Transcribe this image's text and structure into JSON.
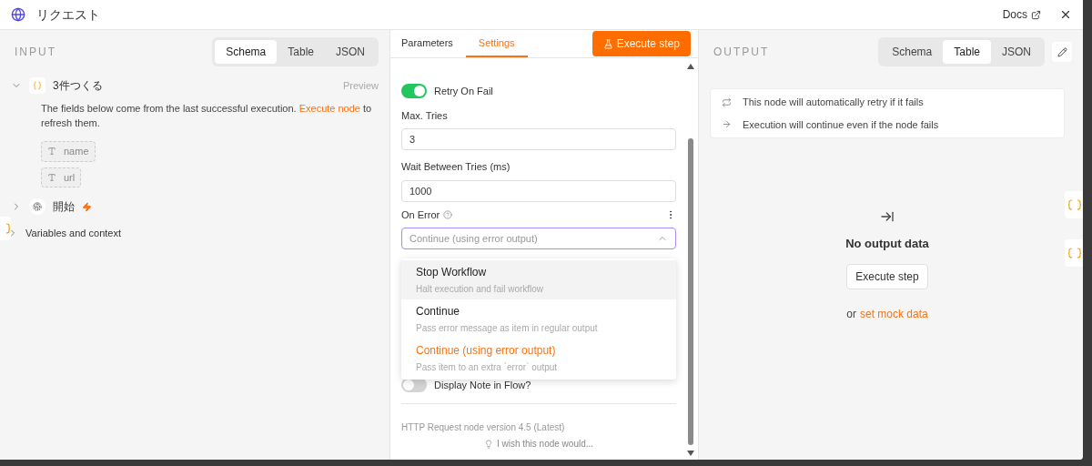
{
  "window": {
    "title": "リクエスト",
    "docs_link": "Docs"
  },
  "input": {
    "heading": "INPUT",
    "view_tabs": [
      {
        "label": "Schema",
        "selected": true
      },
      {
        "label": "Table",
        "selected": false
      },
      {
        "label": "JSON",
        "selected": false
      }
    ],
    "nodes": [
      {
        "kind": "object",
        "name": "3件つくる",
        "expanded": true,
        "preview": "Preview",
        "note_before": "The fields below come from the last successful execution.",
        "note_link": "Execute node",
        "note_after": "to refresh them.",
        "fields": [
          {
            "name": "name"
          },
          {
            "name": "url"
          }
        ]
      },
      {
        "kind": "trigger",
        "name": "開始",
        "expanded": false
      }
    ],
    "variables": {
      "label": "Variables and context",
      "expanded": false
    }
  },
  "settings": {
    "tabs": [
      {
        "label": "Parameters",
        "selected": false
      },
      {
        "label": "Settings",
        "selected": true
      }
    ],
    "execute_button": "Execute step",
    "retry": {
      "label": "Retry On Fail",
      "on": true
    },
    "fields": [
      {
        "label": "Max. Tries",
        "value": "3"
      },
      {
        "label": "Wait Between Tries (ms)",
        "value": "1000"
      }
    ],
    "on_error": {
      "label": "On Error",
      "placeholder": "Continue (using error output)",
      "expanded": true,
      "options": [
        {
          "title": "Stop Workflow",
          "description": "Halt execution and fail workflow",
          "selected": false,
          "hovered": true
        },
        {
          "title": "Continue",
          "description": "Pass error message as item in regular output",
          "selected": false,
          "hovered": false
        },
        {
          "title": "Continue (using error output)",
          "description": "Pass item to an extra `error` output",
          "selected": true,
          "hovered": false
        }
      ]
    },
    "display_note": {
      "label": "Display Note in Flow?",
      "on": false
    },
    "version": "HTTP Request node version 4.5 (Latest)",
    "feedback": "I wish this node would..."
  },
  "output": {
    "heading": "OUTPUT",
    "view_tabs": [
      {
        "label": "Schema",
        "selected": false
      },
      {
        "label": "Table",
        "selected": true
      },
      {
        "label": "JSON",
        "selected": false
      }
    ],
    "notices": [
      {
        "kind": "retry",
        "text": "This node will automatically retry if it fails"
      },
      {
        "kind": "continue",
        "text": "Execution will continue even if the node fails"
      }
    ],
    "empty_title": "No output data",
    "empty_button": "Execute step",
    "or_text": "or",
    "mock_link": "set mock data"
  }
}
